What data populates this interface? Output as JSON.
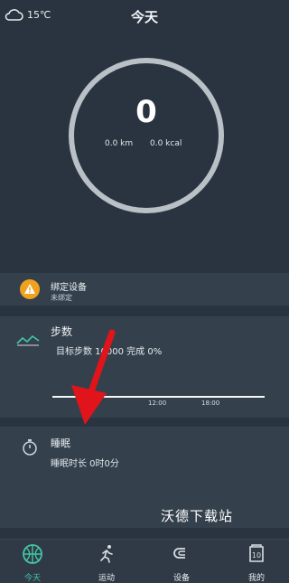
{
  "header": {
    "title": "今天",
    "weather": {
      "temperature": "15℃",
      "icon": "cloud-icon"
    }
  },
  "summary": {
    "value": "0",
    "distance": "0.0 km",
    "calories": "0.0 kcal"
  },
  "bind_device": {
    "title": "绑定设备",
    "subtitle": "未绑定",
    "icon": "warning-icon"
  },
  "steps": {
    "title": "步数",
    "goal_text": "目标步数 10000 完成 0%",
    "ticks": [
      "12:00",
      "18:00"
    ],
    "icon": "steps-trend-icon"
  },
  "sleep": {
    "title": "睡眠",
    "duration_text": "睡眠时长 0时0分",
    "icon": "stopwatch-icon"
  },
  "watermark": "沃德下载站",
  "nav": {
    "items": [
      {
        "label": "今天",
        "icon": "basketball-icon"
      },
      {
        "label": "运动",
        "icon": "run-icon"
      },
      {
        "label": "设备",
        "icon": "device-icon"
      },
      {
        "label": "我的",
        "icon": "profile-icon",
        "badge": "10"
      }
    ]
  },
  "colors": {
    "background": "#2a3440",
    "card": "#34414d",
    "accent": "#43c6a4",
    "warning": "#f0a11e",
    "annotation": "#e0141a"
  }
}
